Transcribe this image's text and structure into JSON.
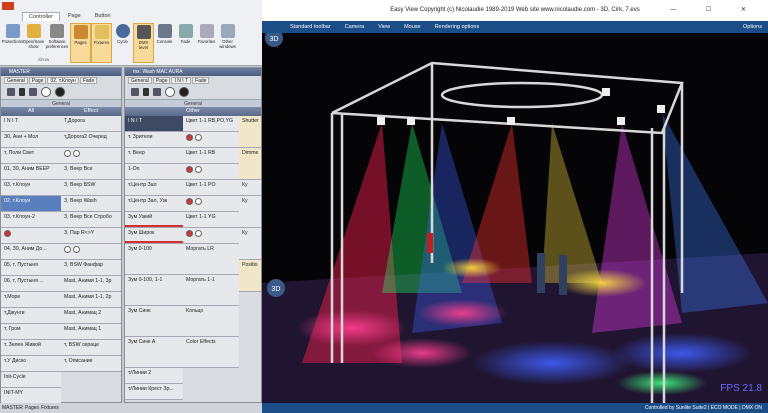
{
  "ribbon": {
    "tabs": [
      "Controller",
      "Page",
      "Button"
    ],
    "buttons": [
      "Protections",
      "Open/Save show",
      "Software preferences",
      "Pages",
      "Fixtures",
      "Cycle",
      "DMX level",
      "Console",
      "Fade",
      "Favorites",
      "Other windows"
    ],
    "groups": [
      "Show"
    ]
  },
  "master_panel": {
    "title": "MASTER",
    "tabs": [
      "General",
      "Page",
      "02. т.Клоун",
      "Fade"
    ],
    "section": "General",
    "columns": [
      "All",
      "Effect"
    ],
    "all_cues": [
      "I N I T",
      "З0, Ани + Мол",
      "т, Поли Свет",
      "01, З0, Аним ВЕЕР",
      "03, т.Клоун",
      "02, т.Клоун",
      "03, т.Клоун-2",
      "",
      "04, З0, Аним До...",
      "05, т, Пустыня",
      "06, т, Пустыня ...",
      "т,Море",
      "т,Джунги",
      "т, Гром",
      "т. Зелен Живой",
      "т.У Диско",
      "Init-Cycle",
      "INIT-MY"
    ],
    "effect_cues": [
      "Т,Дорога",
      "т,Дорога2 Очеред",
      "",
      "З, Веер Все",
      "З, Веер BSW",
      "З, Веер Wash",
      "З, Веер Все Стробо",
      "З, Пар R<>Y",
      "",
      "З, BSW Фанфар",
      "Mast, Аними 1-1, 3p",
      "Mast, Аними 1-1, 2p",
      "Mast, Анимац 2",
      "Mast, Анимац 1",
      "т, BSW серацe",
      "т, Описание"
    ]
  },
  "wash_panel": {
    "title": "mx. Wash MAC AURA",
    "tabs": [
      "General",
      "Page",
      "I N I T",
      "Fade"
    ],
    "section": "General",
    "column": "Other",
    "left_cues": [
      "I N I T",
      "т. Зрители",
      "т. Веер",
      "1-On",
      "т.Центр Зал",
      "т.Центр Зал, Узк",
      "Зум Узкий",
      "Зум Широк",
      "Зум 0-100",
      "Зум 0-100, 1-1",
      "Зум Синк",
      "Зум Синк А",
      "т/Линии 2",
      "т/Линии Крест Зр..."
    ],
    "right_cues": [
      "Цвет 1-1 RB,PO,YG",
      "Цвет 1-1 RB",
      "",
      "Цвет 1-1 PO",
      "",
      "Цвет 1-1 YG",
      "",
      "Моргать LR",
      "Моргать 1-1",
      "Кольцо",
      "Color Effects"
    ],
    "side_cues": [
      "Shutter",
      "Dimme",
      "Ку",
      "Ку",
      "Ку",
      "Positio"
    ]
  },
  "bottom_tabs": [
    "MASTER",
    "Pages",
    "Fixtures"
  ],
  "easyview": {
    "title": "Easy View   Copyright (c) Nicolaudie 1989-2019   Web site www.nicolaudie.com - 3D, Cirk, 7.evs",
    "menu": [
      "Standard toolbar",
      "Camera",
      "View",
      "Mouse",
      "Rendering options"
    ],
    "options": "Options",
    "badge": "3D",
    "fps": "FPS 21.8",
    "status": "Controlled by Sunlite Suite2 | ECO MODE | DMX ON"
  },
  "colors": {
    "menu_blue": "#1b4d86",
    "panel_title": "#4c5d7e",
    "selected_cue": "#5a7fbf"
  }
}
